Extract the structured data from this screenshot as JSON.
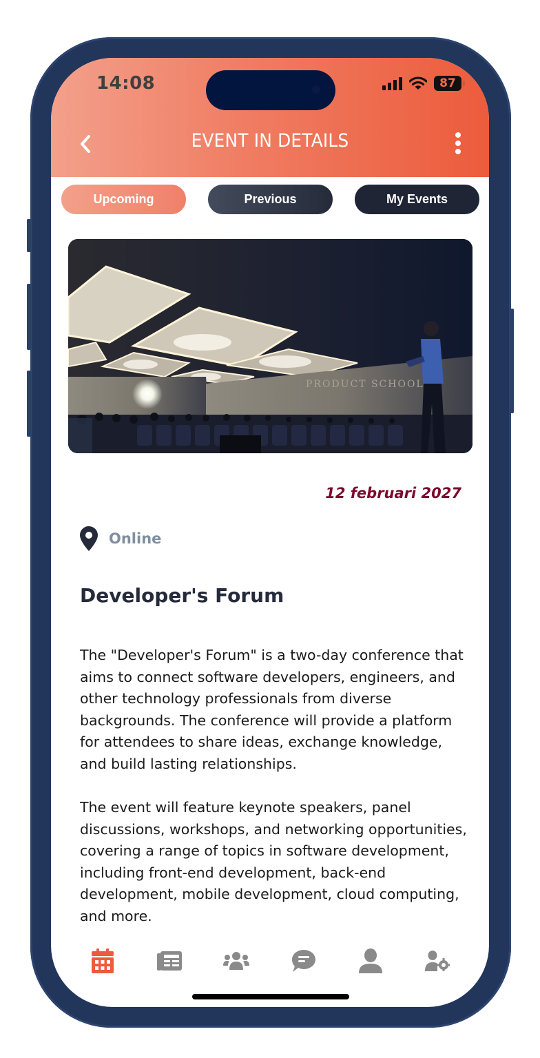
{
  "status_bar": {
    "time": "14:08",
    "battery": "87",
    "icons": [
      "cellular-signal-icon",
      "wifi-icon",
      "battery-icon"
    ]
  },
  "header": {
    "title": "EVENT IN DETAILS",
    "back_icon": "chevron-left-icon",
    "menu_icon": "more-vertical-icon"
  },
  "tabs": [
    {
      "label": "Upcoming",
      "active": true
    },
    {
      "label": "Previous",
      "active": false
    },
    {
      "label": "My Events",
      "active": false
    }
  ],
  "event": {
    "image_alt": "Conference hall with speaker presenting to audience",
    "image_wall_text": "PRODUCT SCHOOL",
    "date": "12 februari 2027",
    "location_icon": "map-pin-icon",
    "location": "Online",
    "title": "Developer's Forum",
    "description": [
      "The \"Developer's Forum\" is a two-day conference that aims to connect software developers, engineers, and other technology professionals from diverse backgrounds. The conference will provide a platform for attendees to share ideas, exchange knowledge, and build lasting relationships.",
      "The event will feature keynote speakers, panel discussions, workshops, and networking opportunities, covering a range of topics in software development, including front-end development, back-end development, mobile development, cloud computing, and more."
    ]
  },
  "bottom_nav": [
    {
      "icon": "calendar-icon",
      "active": true
    },
    {
      "icon": "newspaper-icon",
      "active": false
    },
    {
      "icon": "users-group-icon",
      "active": false
    },
    {
      "icon": "chat-bubble-icon",
      "active": false
    },
    {
      "icon": "user-icon",
      "active": false
    },
    {
      "icon": "user-settings-icon",
      "active": false
    }
  ],
  "colors": {
    "accent": "#ec5c3c",
    "accent_light": "#f3a08b",
    "dark_tab": "#1f2535",
    "date": "#7b0a2e",
    "location_text": "#7f8fa0",
    "icon_inactive": "#8a8a8a",
    "phone_frame": "#22355a"
  }
}
